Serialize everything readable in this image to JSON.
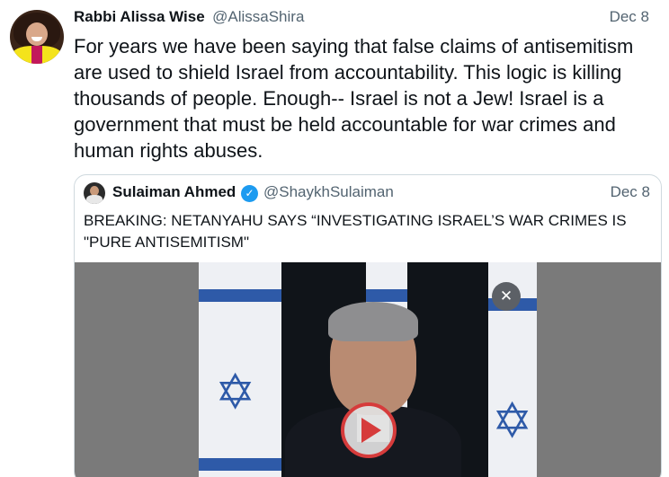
{
  "tweet": {
    "author_name": "Rabbi Alissa Wise",
    "author_handle": "@AlissaShira",
    "date": "Dec 8",
    "text": "For years we have been saying that false claims of antisemitism are used to shield Israel from accountability. This logic is killing thousands of people. Enough-- Israel is not a Jew! Israel is a government that must be held accountable for war crimes and human rights abuses."
  },
  "quoted_tweet": {
    "author_name": "Sulaiman Ahmed",
    "verified_icon": "check",
    "author_handle": "@ShaykhSulaiman",
    "date": "Dec 8",
    "text": "BREAKING: NETANYAHU SAYS “INVESTIGATING ISRAEL’S WAR CRIMES IS \"PURE ANTISEMITISM\"",
    "media": {
      "type": "video",
      "play_icon": "play-icon",
      "play_color": "#d63b3b",
      "watermark_icon": "muted-speaker-icon"
    }
  },
  "colors": {
    "text_primary": "#0f1419",
    "text_secondary": "#536471",
    "verified": "#1d9bf0",
    "border": "#cfd9de",
    "flag_blue": "#2e5aa8"
  }
}
